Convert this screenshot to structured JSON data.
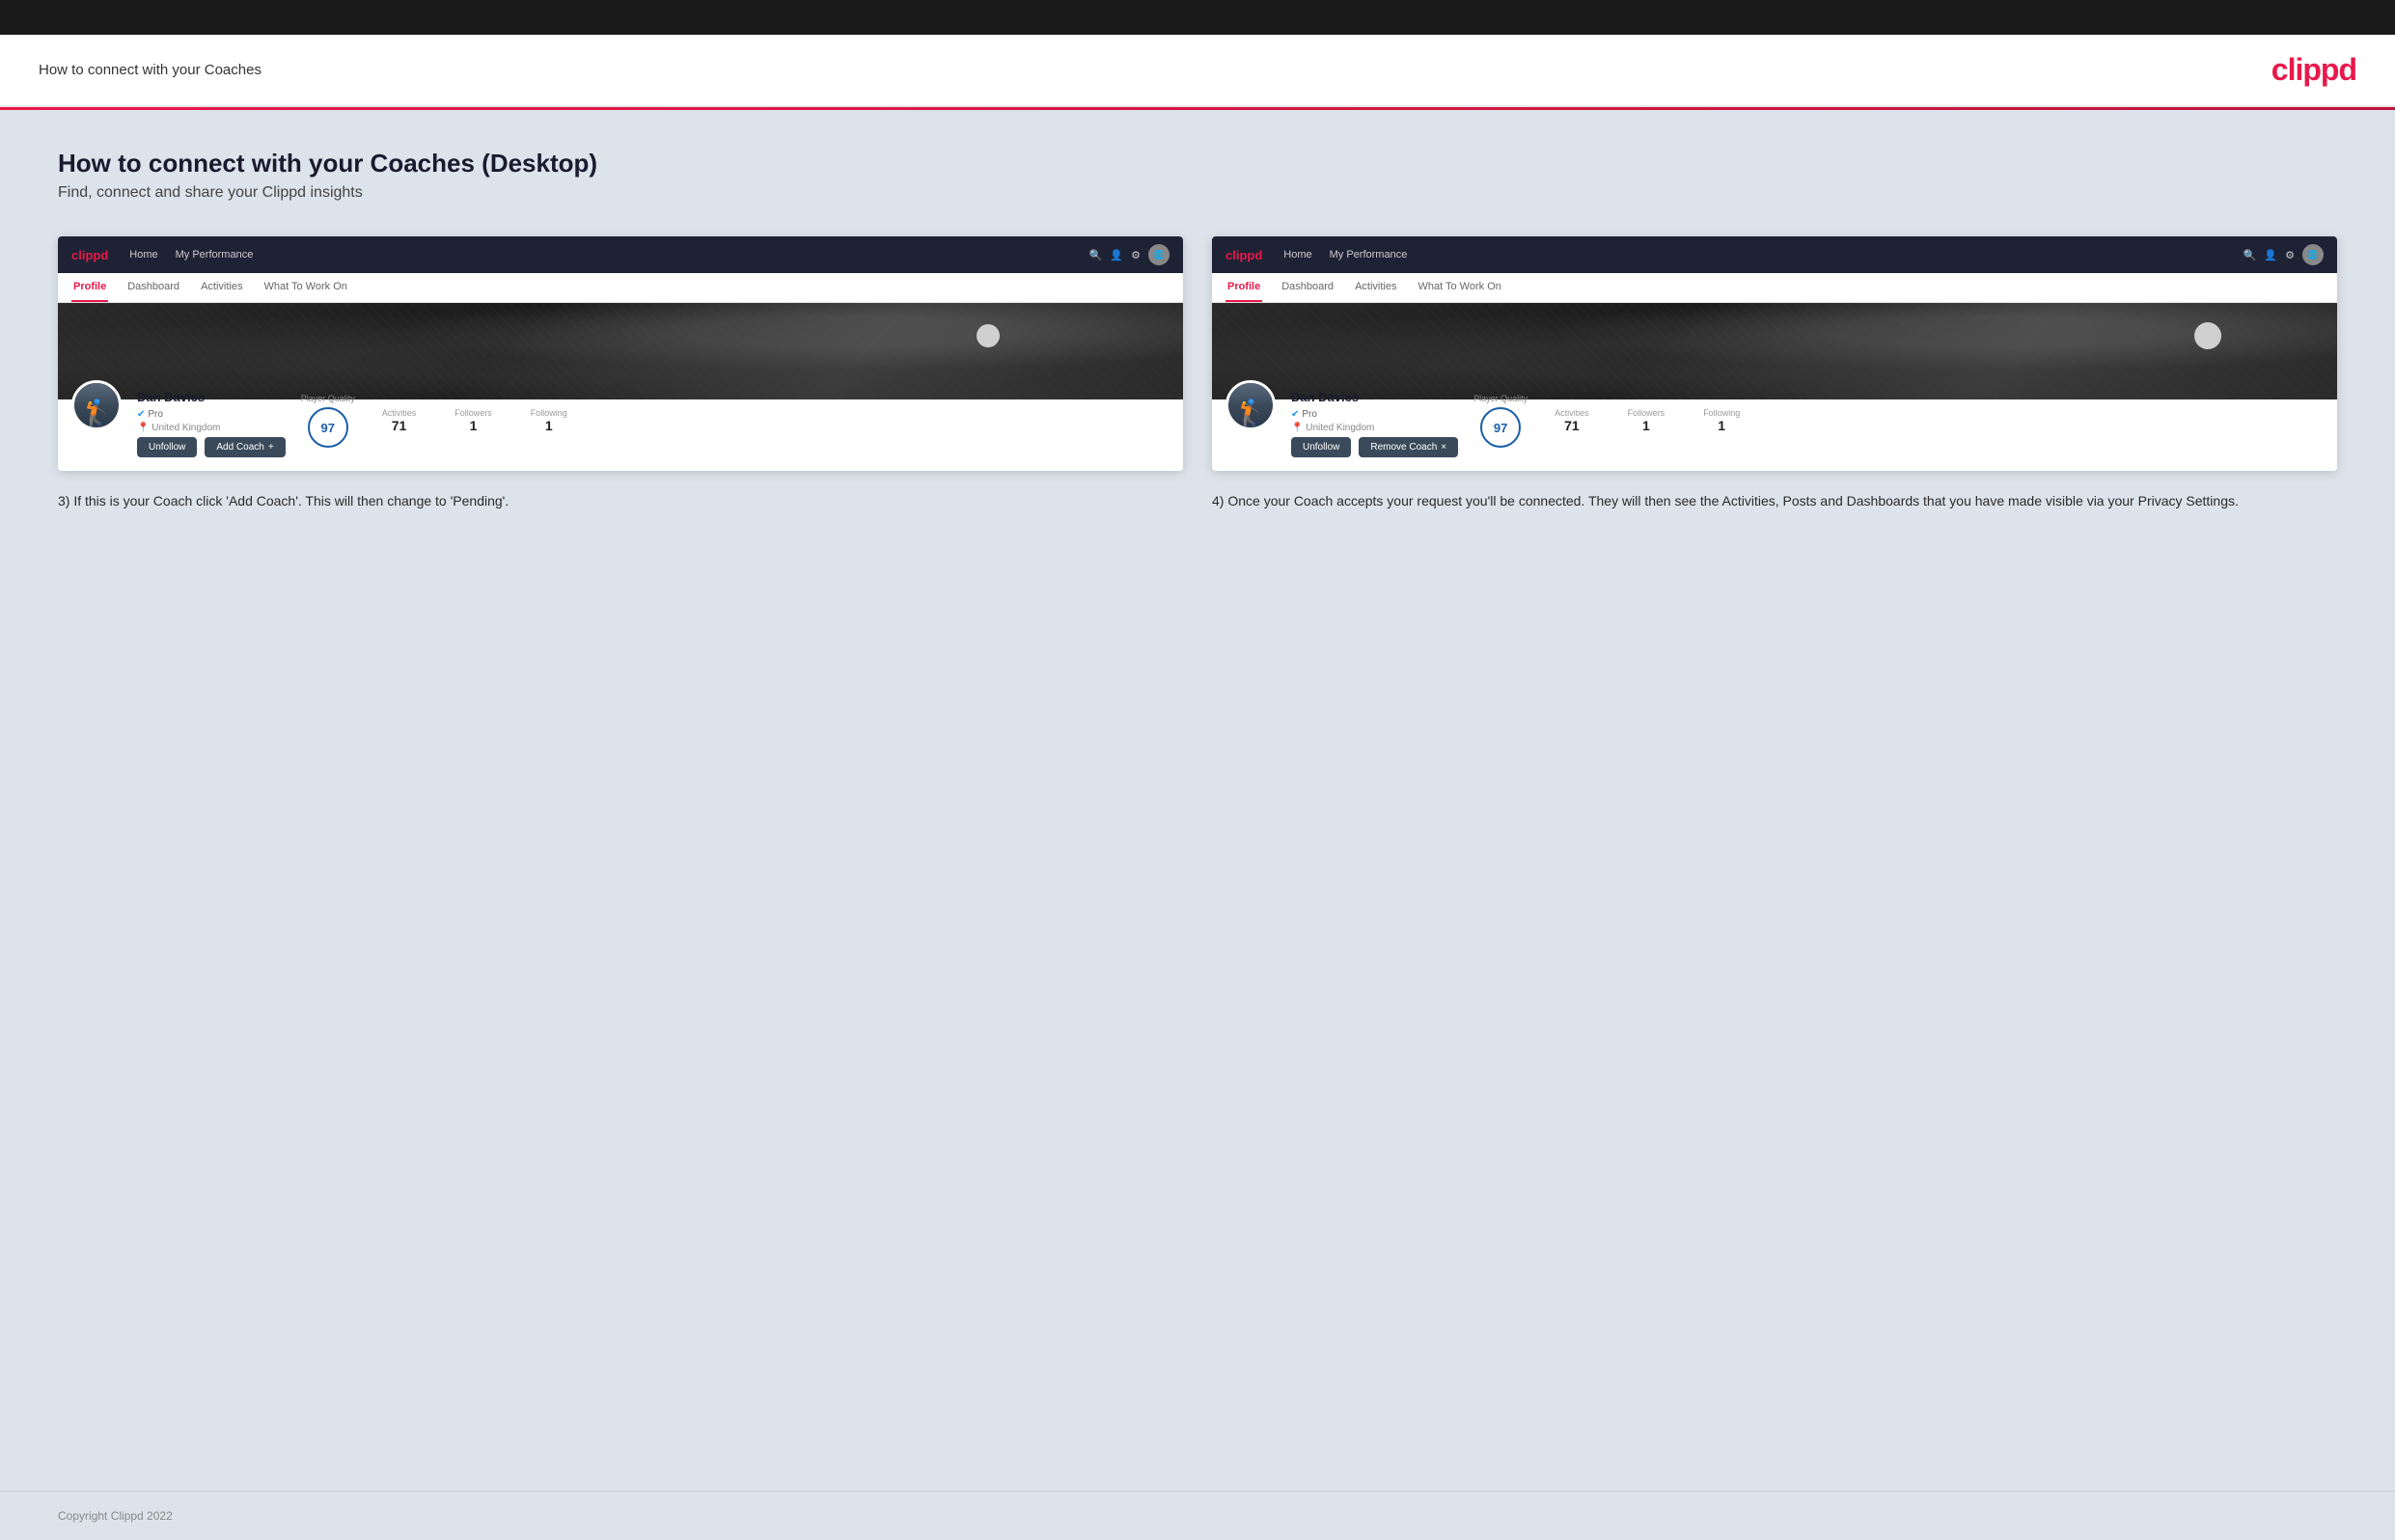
{
  "topbar": {
    "bg": "#1a1a1a"
  },
  "header": {
    "title": "How to connect with your Coaches",
    "logo": "clippd"
  },
  "main": {
    "title": "How to connect with your Coaches (Desktop)",
    "subtitle": "Find, connect and share your Clippd insights",
    "screenshot_left": {
      "nav": {
        "logo": "clippd",
        "links": [
          "Home",
          "My Performance"
        ],
        "icons": [
          "search",
          "user",
          "settings",
          "globe"
        ]
      },
      "tabs": [
        "Profile",
        "Dashboard",
        "Activities",
        "What To Work On"
      ],
      "active_tab": "Profile",
      "banner_alt": "Aerial golf course view",
      "profile": {
        "name": "Dan Davies",
        "badge": "Pro",
        "location": "United Kingdom",
        "player_quality_label": "Player Quality",
        "player_quality_value": "97",
        "activities_label": "Activities",
        "activities_value": "71",
        "followers_label": "Followers",
        "followers_value": "1",
        "following_label": "Following",
        "following_value": "1"
      },
      "buttons": {
        "unfollow": "Unfollow",
        "add_coach": "Add Coach",
        "add_icon": "+"
      }
    },
    "screenshot_right": {
      "nav": {
        "logo": "clippd",
        "links": [
          "Home",
          "My Performance"
        ],
        "icons": [
          "search",
          "user",
          "settings",
          "globe"
        ]
      },
      "tabs": [
        "Profile",
        "Dashboard",
        "Activities",
        "What To Work On"
      ],
      "active_tab": "Profile",
      "banner_alt": "Aerial golf course view",
      "profile": {
        "name": "Dan Davies",
        "badge": "Pro",
        "location": "United Kingdom",
        "player_quality_label": "Player Quality",
        "player_quality_value": "97",
        "activities_label": "Activities",
        "activities_value": "71",
        "followers_label": "Followers",
        "followers_value": "1",
        "following_label": "Following",
        "following_value": "1"
      },
      "buttons": {
        "unfollow": "Unfollow",
        "remove_coach": "Remove Coach",
        "remove_icon": "×"
      }
    },
    "caption_left": "3) If this is your Coach click 'Add Coach'. This will then change to 'Pending'.",
    "caption_right": "4) Once your Coach accepts your request you'll be connected. They will then see the Activities, Posts and Dashboards that you have made visible via your Privacy Settings."
  },
  "footer": {
    "text": "Copyright Clippd 2022"
  }
}
